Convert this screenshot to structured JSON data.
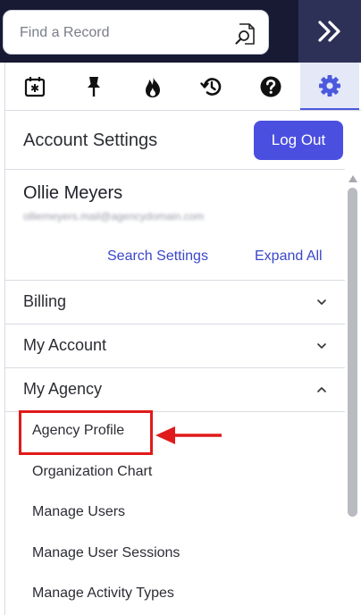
{
  "search": {
    "placeholder": "Find a Record"
  },
  "tabs": [
    {
      "icon": "calendar-star-icon",
      "active": false
    },
    {
      "icon": "pin-icon",
      "active": false
    },
    {
      "icon": "fire-icon",
      "active": false
    },
    {
      "icon": "history-icon",
      "active": false
    },
    {
      "icon": "help-icon",
      "active": false
    },
    {
      "icon": "gear-icon",
      "active": true
    }
  ],
  "header": {
    "title": "Account Settings",
    "logout_label": "Log Out"
  },
  "user": {
    "name": "Ollie Meyers",
    "email": "olliemeyers.mail@agencydomain.com"
  },
  "links": {
    "search_settings": "Search Settings",
    "expand_all": "Expand All"
  },
  "sections": [
    {
      "label": "Billing",
      "expanded": false
    },
    {
      "label": "My Account",
      "expanded": false
    },
    {
      "label": "My Agency",
      "expanded": true
    }
  ],
  "agency_items": [
    "Agency Profile",
    "Organization Chart",
    "Manage Users",
    "Manage User Sessions",
    "Manage Activity Types"
  ],
  "colors": {
    "topbar": "#181a33",
    "accent": "#4b4fe0",
    "link": "#3a47c9",
    "highlight": "#e01a1a"
  }
}
